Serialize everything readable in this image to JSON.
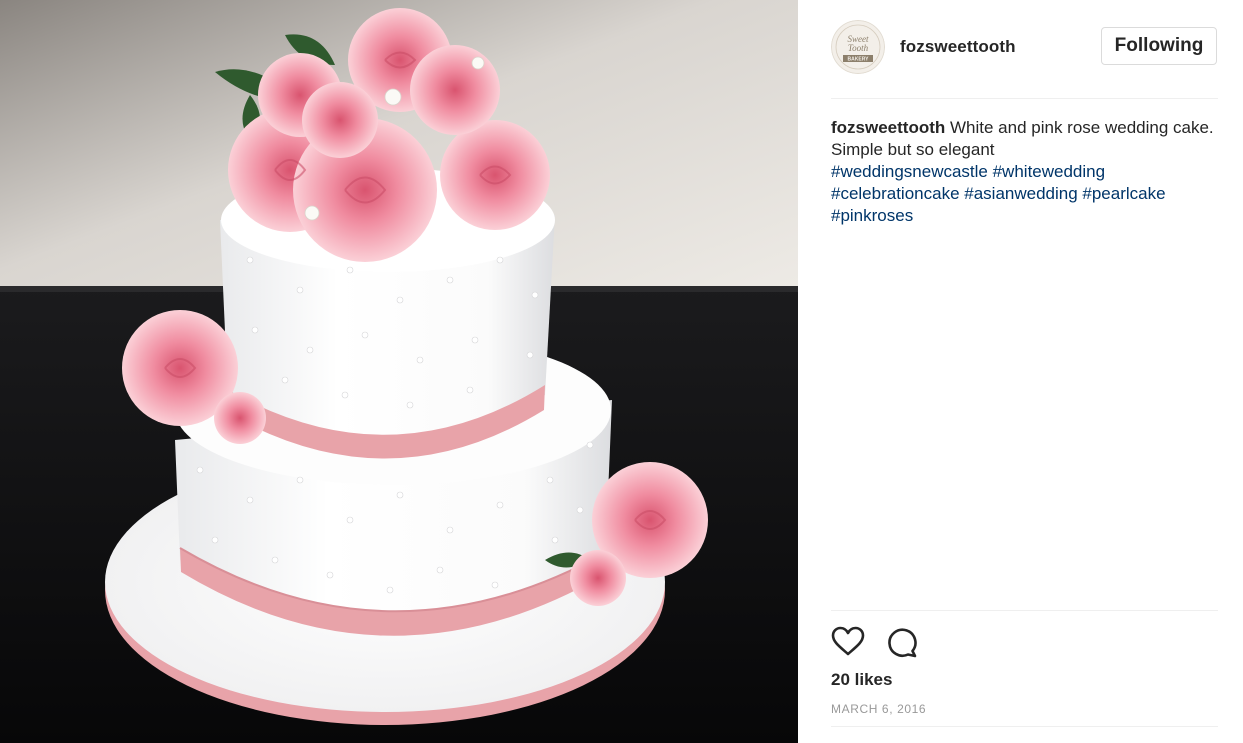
{
  "post": {
    "image_alt": "White and pink rose wedding cake",
    "author": {
      "username": "fozsweettooth",
      "avatar_lines": [
        "Sweet",
        "Tooth",
        "BAKERY"
      ]
    },
    "follow_label": "Following",
    "caption": {
      "username": "fozsweettooth",
      "text": " White and pink rose wedding cake. Simple but so elegant",
      "hashtags": "#weddingsnewcastle #whitewedding #celebrationcake #asianwedding #pearlcake #pinkroses"
    },
    "likes": "20 likes",
    "date": "MARCH 6, 2016",
    "colors": {
      "hashtag": "#003569",
      "text": "#262626",
      "muted": "#999999",
      "border": "#dbdbdb",
      "ribbon": "#e8a3a9",
      "rose": "#f08ca0"
    },
    "icons": [
      "heart-icon",
      "comment-icon"
    ]
  }
}
